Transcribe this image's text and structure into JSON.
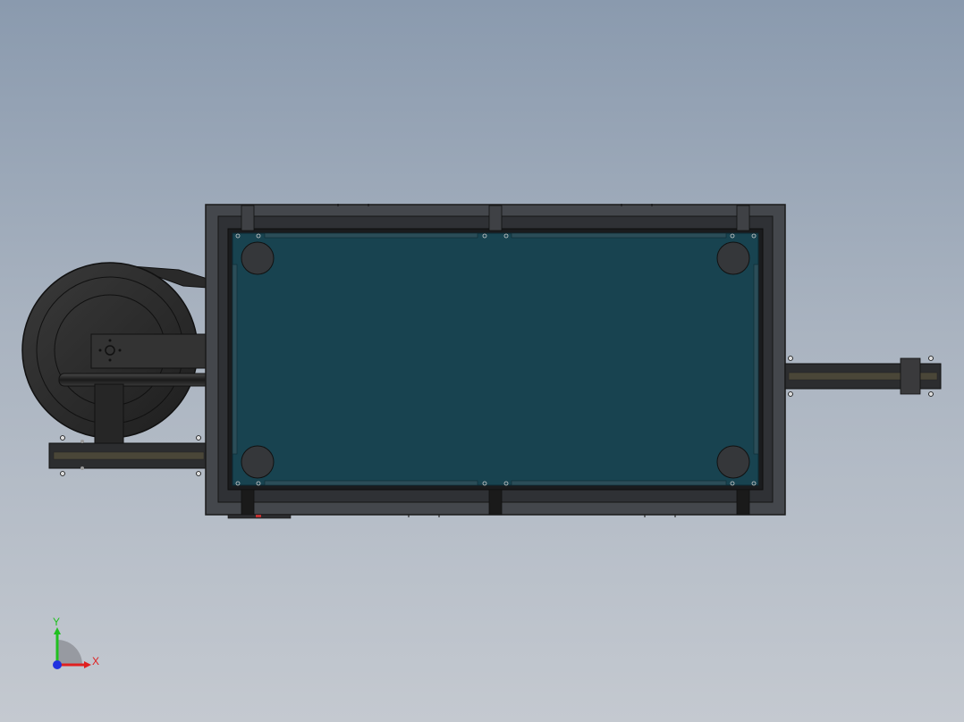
{
  "view": {
    "background_top": "#8a9aae",
    "background_bottom": "#c4c9d0"
  },
  "model": {
    "felt_color": "#184350",
    "frame_color": "#3b3e43",
    "frame_dark": "#1f2124",
    "reel_color": "#2b2b2b",
    "pocket_color": "#35373a"
  },
  "triad": {
    "x_label": "X",
    "y_label": "Y",
    "x_color": "#e02020",
    "y_color": "#20c020",
    "z_color": "#2030e0"
  }
}
